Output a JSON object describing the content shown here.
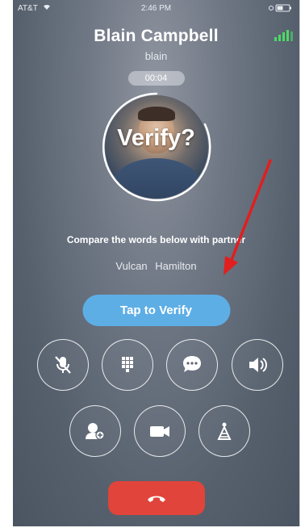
{
  "status_bar": {
    "carrier": "AT&T",
    "time": "2:46 PM"
  },
  "call": {
    "caller_name": "Blain Campbell",
    "caller_username": "blain",
    "duration": "00:04"
  },
  "verification": {
    "overlay_text": "Verify?",
    "prompt": "Compare the words below with partner",
    "words": [
      "Vulcan",
      "Hamilton"
    ],
    "button_label": "Tap to Verify"
  },
  "controls": {
    "row1": [
      "mute-microphone",
      "dialpad",
      "chat",
      "speaker"
    ],
    "row2": [
      "add-participant",
      "video",
      "network-quality"
    ]
  },
  "colors": {
    "verify_button": "#5eaee6",
    "end_call": "#e0443b",
    "signal": "#4cd964",
    "annotation_arrow": "#e21e1e"
  }
}
